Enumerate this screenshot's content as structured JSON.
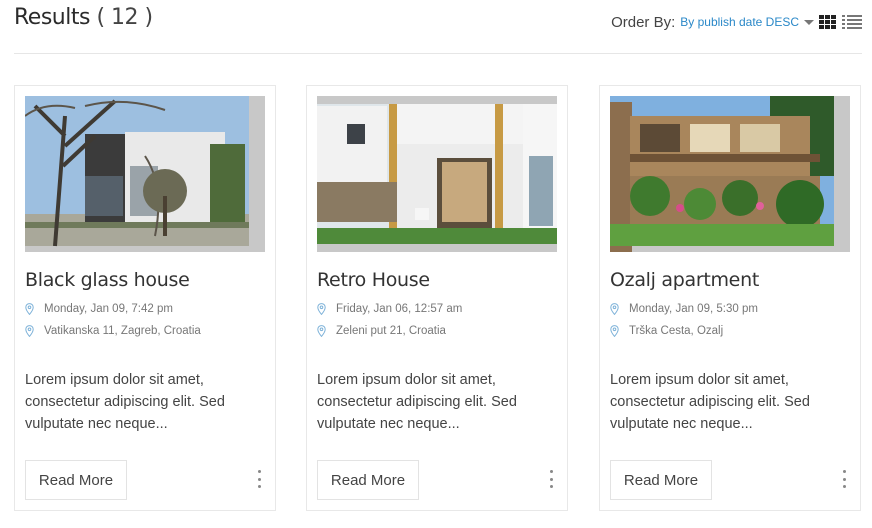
{
  "header": {
    "results_label": "Results",
    "results_count": "( 12 )",
    "order_label": "Order By:",
    "order_value": "By publish date DESC",
    "icons": [
      "chevron-down-icon",
      "grid-view-icon",
      "list-view-icon"
    ]
  },
  "cards": [
    {
      "title": "Black glass house",
      "date": "Monday, Jan 09, 7:42 pm",
      "address": "Vatikanska 11, Zagreb, Croatia",
      "description": "Lorem ipsum dolor sit amet, consectetur adipiscing elit. Sed vulputate nec neque...",
      "button": "Read More"
    },
    {
      "title": "Retro House",
      "date": "Friday, Jan 06, 12:57 am",
      "address": "Zeleni put 21, Croatia",
      "description": "Lorem ipsum dolor sit amet, consectetur adipiscing elit. Sed vulputate nec neque...",
      "button": "Read More"
    },
    {
      "title": "Ozalj apartment",
      "date": "Monday, Jan 09, 5:30 pm",
      "address": "Trška Cesta, Ozalj",
      "description": "Lorem ipsum dolor sit amet, consectetur adipiscing elit. Sed vulputate nec neque...",
      "button": "Read More"
    }
  ],
  "colors": {
    "accent": "#2a88c8",
    "pin": "#7fb3d9"
  }
}
